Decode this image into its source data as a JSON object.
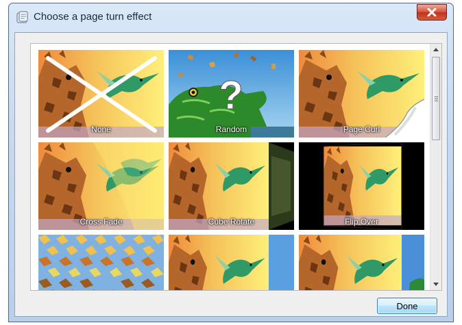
{
  "window": {
    "title": "Choose a page turn effect"
  },
  "effects": [
    {
      "label": "None",
      "selected": true
    },
    {
      "label": "Random",
      "selected": false
    },
    {
      "label": "Page Curl",
      "selected": false
    },
    {
      "label": "Cross Fade",
      "selected": false
    },
    {
      "label": "Cube Rotate",
      "selected": false
    },
    {
      "label": "Flip Over",
      "selected": false
    },
    {
      "label": "",
      "selected": false
    },
    {
      "label": "",
      "selected": false
    },
    {
      "label": "",
      "selected": false
    }
  ],
  "buttons": {
    "done_label": "Done"
  },
  "colors": {
    "selection": "#1a1aa6",
    "close": "#c7432b",
    "button_border": "#3c7fb1"
  }
}
